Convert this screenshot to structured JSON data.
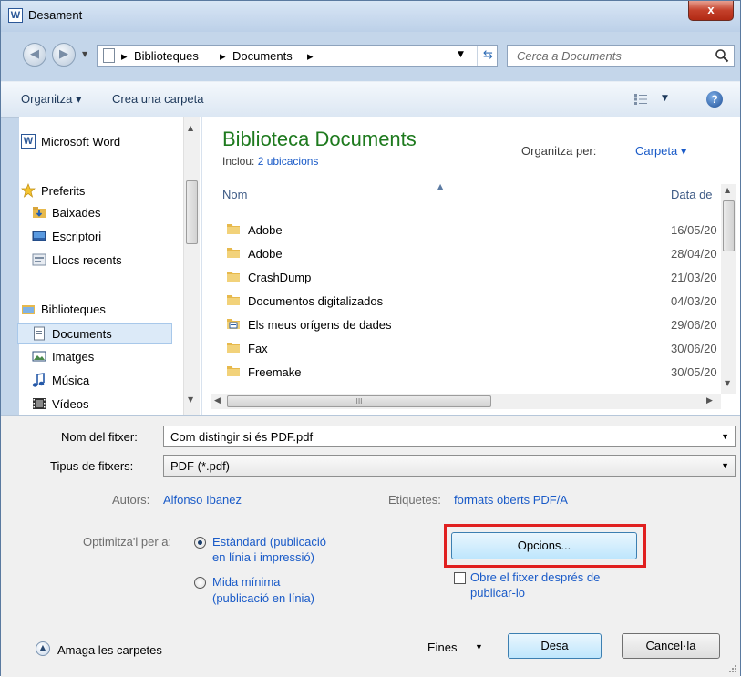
{
  "window": {
    "title": "Desament",
    "app_icon_letter": "W",
    "close_label": "x"
  },
  "address_bar": {
    "crumbs": [
      "Biblioteques",
      "Documents"
    ],
    "search_placeholder": "Cerca a Documents"
  },
  "toolbar": {
    "organize_label": "Organitza ▾",
    "new_folder_label": "Crea una carpeta",
    "help_label": "?"
  },
  "nav_pane": {
    "items": [
      {
        "label": "Microsoft Word",
        "icon": "word-icon"
      },
      {
        "label": "Preferits",
        "icon": "star-icon"
      },
      {
        "label": "Baixades",
        "icon": "downloads-icon"
      },
      {
        "label": "Escriptori",
        "icon": "desktop-icon"
      },
      {
        "label": "Llocs recents",
        "icon": "recent-places-icon"
      },
      {
        "label": "Biblioteques",
        "icon": "libraries-icon"
      },
      {
        "label": "Documents",
        "icon": "documents-icon"
      },
      {
        "label": "Imatges",
        "icon": "pictures-icon"
      },
      {
        "label": "Música",
        "icon": "music-icon"
      },
      {
        "label": "Vídeos",
        "icon": "videos-icon"
      }
    ],
    "selected": "Documents"
  },
  "content": {
    "library_title": "Biblioteca Documents",
    "includes_prefix": "Inclou:",
    "includes_link": "2 ubicacions",
    "arrange_label": "Organitza per:",
    "arrange_value": "Carpeta ▾",
    "columns": {
      "name": "Nom",
      "date": "Data de"
    },
    "files": [
      {
        "name": "Adobe",
        "date": "16/05/20",
        "icon": "folder-icon"
      },
      {
        "name": "Adobe",
        "date": "28/04/20",
        "icon": "folder-icon"
      },
      {
        "name": "CrashDump",
        "date": "21/03/20",
        "icon": "folder-icon"
      },
      {
        "name": "Documentos digitalizados",
        "date": "04/03/20",
        "icon": "folder-icon"
      },
      {
        "name": "Els meus orígens de dades",
        "date": "29/06/20",
        "icon": "data-sources-folder-icon"
      },
      {
        "name": "Fax",
        "date": "30/06/20",
        "icon": "folder-icon"
      },
      {
        "name": "Freemake",
        "date": "30/05/20",
        "icon": "folder-icon"
      }
    ],
    "hscroll_grip": "III"
  },
  "form": {
    "filename_label": "Nom del fitxer:",
    "filename_value": "Com distingir si és PDF.pdf",
    "filetype_label": "Tipus de fitxers:",
    "filetype_value": "PDF (*.pdf)",
    "authors_label": "Autors:",
    "authors_value": "Alfonso Ibanez",
    "tags_label": "Etiquetes:",
    "tags_value": "formats oberts PDF/A",
    "optimize_label": "Optimitza'l per a:",
    "option_standard_line1": "Estàndard (publicació",
    "option_standard_line2": "en línia i impressió)",
    "option_min_line1": "Mida mínima",
    "option_min_line2": "(publicació en línia)",
    "options_button": "Opcions...",
    "open_after_line1": "Obre el fitxer després de",
    "open_after_line2": "publicar-lo",
    "hide_folders_label": "Amaga les carpetes",
    "tools_label": "Eines",
    "save_button": "Desa",
    "cancel_button": "Cancel·la"
  }
}
